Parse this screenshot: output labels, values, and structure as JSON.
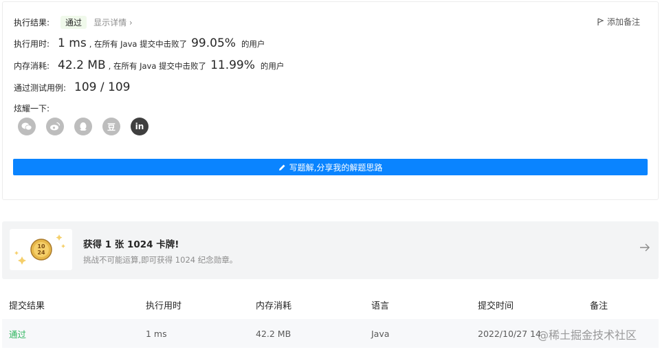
{
  "result": {
    "status_label": "执行结果:",
    "status_value": "通过",
    "detail_link": "显示详情 ›",
    "add_note": "添加备注",
    "runtime": {
      "label": "执行用时:",
      "value": "1 ms",
      "beat_prefix": ", 在所有 Java 提交中击败了",
      "percent": "99.05%",
      "suffix": "的用户"
    },
    "memory": {
      "label": "内存消耗:",
      "value": "42.2 MB",
      "beat_prefix": ", 在所有 Java 提交中击败了",
      "percent": "11.99%",
      "suffix": "的用户"
    },
    "tests": {
      "label": "通过测试用例:",
      "value": "109 / 109"
    },
    "share_label": "炫耀一下:",
    "share_icons": [
      "wechat-icon",
      "weibo-icon",
      "qq-icon",
      "douban-icon",
      "linkedin-icon"
    ],
    "douban_glyph": "豆",
    "linkedin_glyph": "in",
    "write_button": "写题解,分享我的解题思路"
  },
  "award": {
    "title": "获得 1 张 1024 卡牌!",
    "subtitle": "挑战不可能运算,即可获得 1024 纪念勋章。",
    "badge_text_top": "10",
    "badge_text_bottom": "24"
  },
  "table": {
    "headers": [
      "提交结果",
      "执行用时",
      "内存消耗",
      "语言",
      "提交时间",
      "备注"
    ],
    "rows": [
      [
        "通过",
        "1 ms",
        "42.2 MB",
        "Java",
        "2022/10/27 14",
        ""
      ]
    ]
  },
  "watermark": "@稀土掘金技术社区",
  "colors": {
    "accent": "#0a84ff",
    "success": "#2db55d",
    "badge_bg": "#f0f9eb",
    "banner_bg": "#f3f4f5"
  }
}
